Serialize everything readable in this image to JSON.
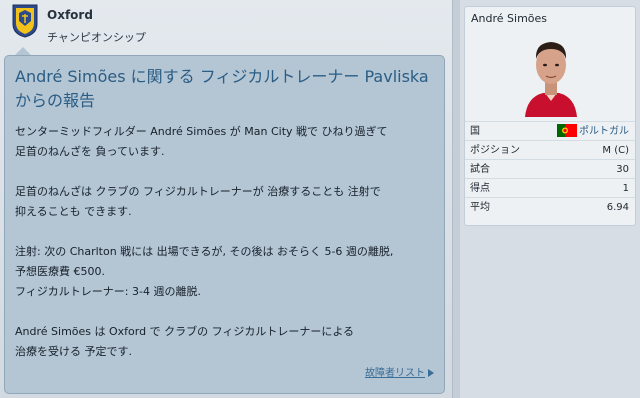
{
  "club": {
    "name": "Oxford",
    "league": "チャンピオンシップ",
    "badge_icon": "club-badge-icon",
    "colors": {
      "badge_blue": "#2d4a8a",
      "badge_yellow": "#f2c21b"
    }
  },
  "message": {
    "title": "André Simões に関する フィジカルトレーナー Pavliska からの報告",
    "paragraphs": [
      "センターミッドフィルダー André Simões が Man City 戦で ひねり過ぎて\n足首のねんざを 負っています.",
      "足首のねんざは クラブの フィジカルトレーナーが 治療することも 注射で\n抑えることも できます.",
      "注射: 次の Charlton 戦には 出場できるが, その後は おそらく 5-6 週の離脱,\n予想医療費 €500.\nフィジカルトレーナー: 3-4 週の離脱.",
      "André Simões は Oxford で クラブの フィジカルトレーナーによる\n治療を受ける 予定です."
    ],
    "link_label": "故障者リスト",
    "link_icon": "arrow-right-icon",
    "colors": {
      "title": "#2a5d85",
      "background": "#b4c5d4"
    }
  },
  "player": {
    "name": "André Simões",
    "photo_icon": "player-photo",
    "stats": [
      {
        "label": "国",
        "value": "ポルトガル",
        "icon": "portugal-flag-icon"
      },
      {
        "label": "ポジション",
        "value": "M (C)"
      },
      {
        "label": "試合",
        "value": "30"
      },
      {
        "label": "得点",
        "value": "1"
      },
      {
        "label": "平均",
        "value": "6.94"
      }
    ]
  }
}
